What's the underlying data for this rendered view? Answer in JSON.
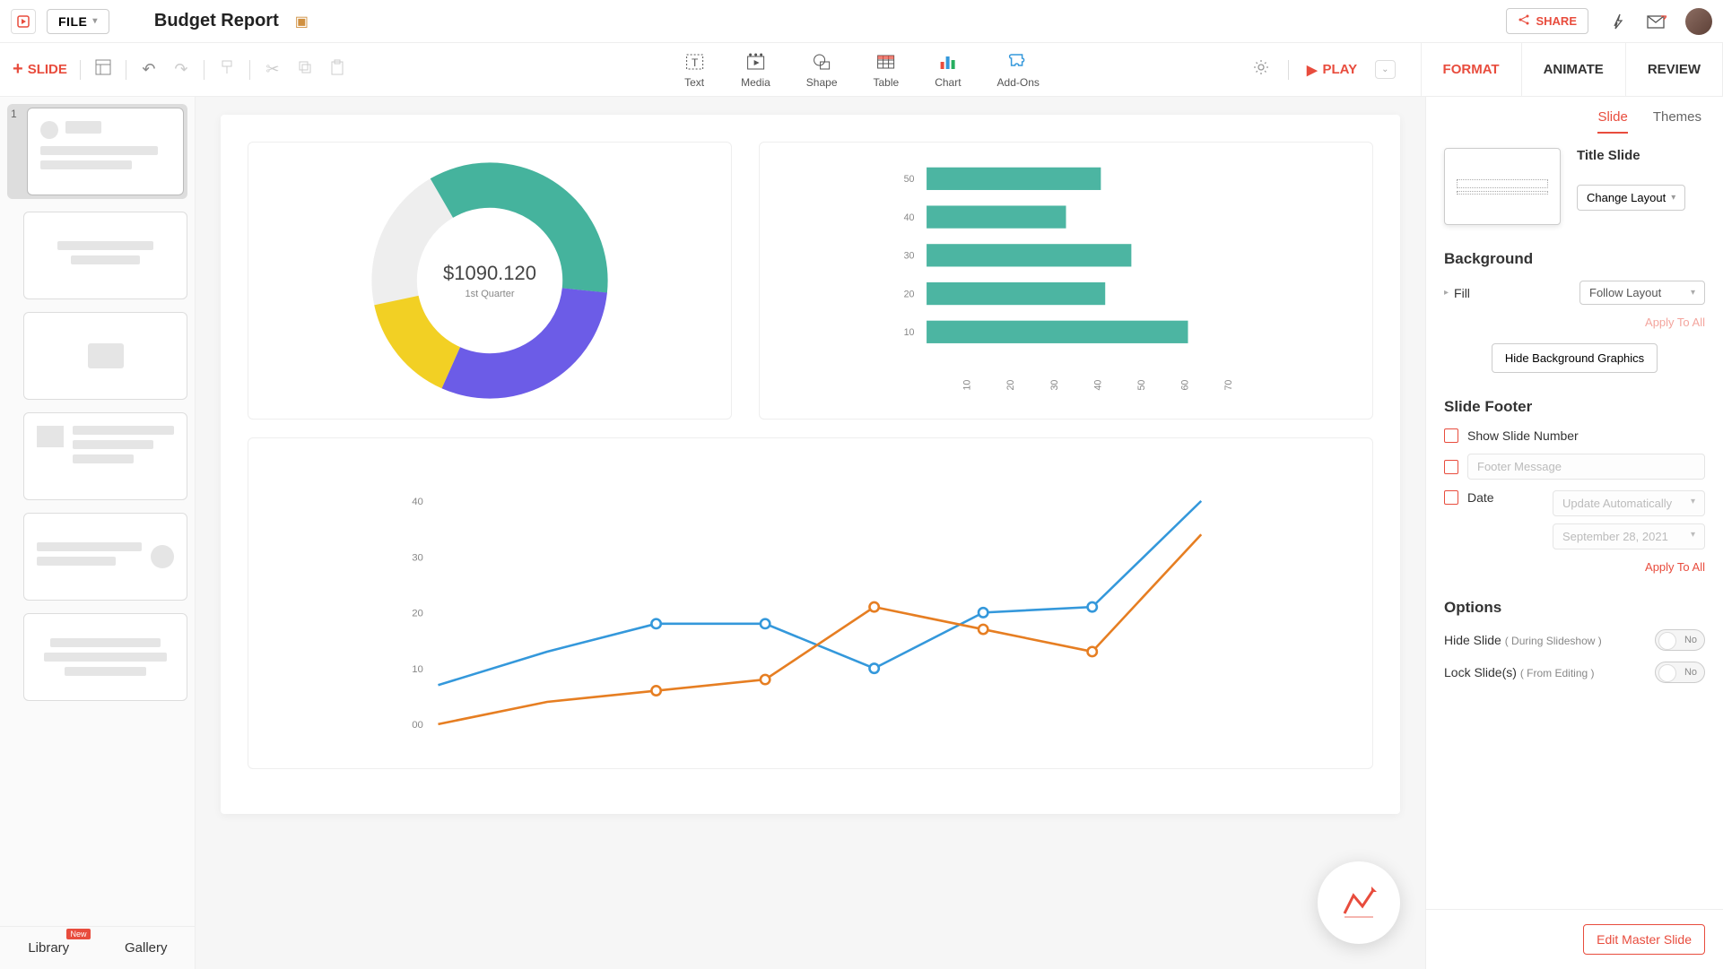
{
  "header": {
    "file_menu_label": "FILE",
    "doc_title": "Budget Report",
    "share_label": "SHARE"
  },
  "toolbar": {
    "add_slide_label": "SLIDE",
    "play_label": "PLAY",
    "tools": {
      "text": "Text",
      "media": "Media",
      "shape": "Shape",
      "table": "Table",
      "chart": "Chart",
      "addons": "Add-Ons"
    }
  },
  "rp_tabs": {
    "format": "FORMAT",
    "animate": "ANIMATE",
    "review": "REVIEW"
  },
  "slides": {
    "first_index": "1",
    "library_tab": "Library",
    "gallery_tab": "Gallery",
    "new_badge": "New"
  },
  "right_panel": {
    "sub_slide": "Slide",
    "sub_themes": "Themes",
    "layout_name": "Title Slide",
    "change_layout": "Change Layout",
    "bg_title": "Background",
    "fill_label": "Fill",
    "fill_value": "Follow Layout",
    "apply_all": "Apply To All",
    "hide_bg_graphics": "Hide Background Graphics",
    "footer_title": "Slide Footer",
    "show_slide_number": "Show Slide Number",
    "footer_message_ph": "Footer Message",
    "date_label": "Date",
    "date_mode": "Update Automatically",
    "date_value": "September 28, 2021",
    "options_title": "Options",
    "hide_slide": "Hide Slide",
    "hide_slide_sub": "( During Slideshow )",
    "lock_slide": "Lock Slide(s)",
    "lock_slide_sub": "( From Editing )",
    "toggle_no": "No",
    "edit_master": "Edit Master Slide"
  },
  "chart_data": [
    {
      "type": "donut",
      "center_value": "$1090.120",
      "center_label": "1st Quarter",
      "slices": [
        {
          "label": "teal",
          "value": 35,
          "color": "#45b39d"
        },
        {
          "label": "purple",
          "value": 30,
          "color": "#6c5ce7"
        },
        {
          "label": "yellow",
          "value": 15,
          "color": "#f2d024"
        },
        {
          "label": "gap",
          "value": 20,
          "color": "#ffffff"
        }
      ]
    },
    {
      "type": "bar-horizontal",
      "categories": [
        "50",
        "40",
        "30",
        "20",
        "10"
      ],
      "values": [
        40,
        32,
        47,
        41,
        60
      ],
      "x_ticks": [
        "10",
        "20",
        "30",
        "40",
        "50",
        "60",
        "70"
      ],
      "color": "#4cb5a2"
    },
    {
      "type": "line",
      "x": [
        0,
        1,
        2,
        3,
        4,
        5,
        6,
        7
      ],
      "y_ticks": [
        "00",
        "10",
        "20",
        "30",
        "40"
      ],
      "series": [
        {
          "name": "blue",
          "color": "#3498db",
          "values": [
            7,
            13,
            18,
            18,
            10,
            20,
            21,
            40
          ]
        },
        {
          "name": "orange",
          "color": "#e67e22",
          "values": [
            0,
            4,
            6,
            8,
            21,
            17,
            13,
            34
          ]
        }
      ],
      "ylim": [
        0,
        45
      ]
    }
  ]
}
